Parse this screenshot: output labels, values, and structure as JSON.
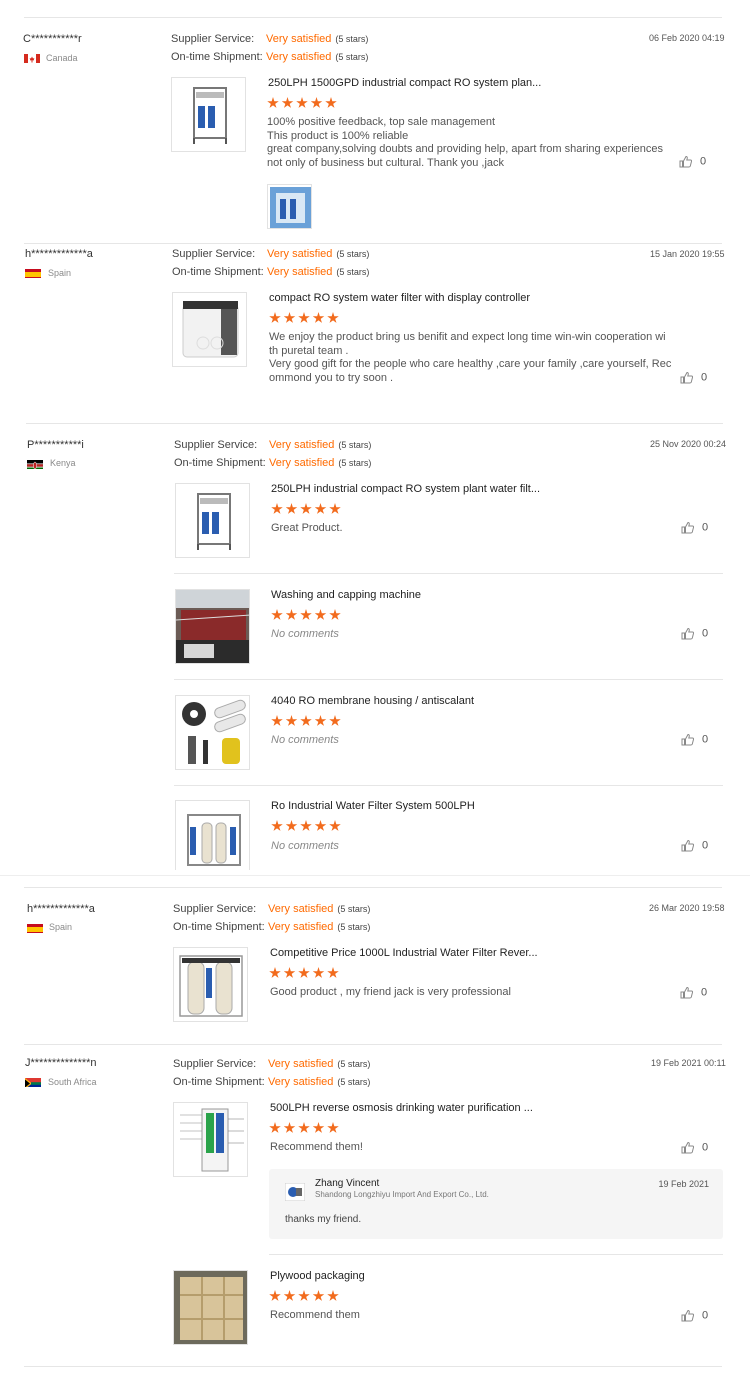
{
  "labels": {
    "supplier_service": "Supplier Service:",
    "ontime_shipment": "On-time Shipment:",
    "very_satisfied": "Very satisfied",
    "five_stars": "(5 stars)"
  },
  "colors": {
    "accent": "#ff6a00",
    "star": "#f26b1d",
    "divider": "#e6e6e6"
  },
  "reviews": [
    {
      "user": "C***********r",
      "country": "Canada",
      "flag": "canada-flag-icon",
      "date": "06 Feb 2020 04:19",
      "products": [
        {
          "name": "250LPH 1500GPD industrial compact RO system plan...",
          "comment": [
            "100% positive feedback, top sale management",
            "This product is 100% reliable",
            "great company,solving doubts and providing help, apart from sharing experiences",
            "not only of business but cultural. Thank you ,jack"
          ],
          "likes": "0",
          "thumb": "ro-system-thumbnail-icon"
        }
      ]
    },
    {
      "user": "h*************a",
      "country": "Spain",
      "flag": "spain-flag-icon",
      "date": "15 Jan 2020 19:55",
      "products": [
        {
          "name": "compact RO system water filter with display controller",
          "comment": [
            "We enjoy the product bring us benifit and expect long time win-win cooperation wi",
            "th puretal team .",
            "Very good gift for the people who care healthy ,care your family ,care yourself, Rec",
            "ommond you to try soon ."
          ],
          "likes": "0",
          "thumb": "water-filter-unit-icon"
        }
      ]
    },
    {
      "user": "P***********i",
      "country": "Kenya",
      "flag": "kenya-flag-icon",
      "date": "25 Nov 2020 00:24",
      "products": [
        {
          "name": "250LPH industrial compact RO system plant water filt...",
          "comment": [
            "Great Product."
          ],
          "likes": "0",
          "thumb": "ro-system-thumbnail-icon"
        },
        {
          "name": "Washing and capping machine",
          "no_comments": "No comments",
          "likes": "0",
          "thumb": "washing-machine-photo-icon"
        },
        {
          "name": "4040 RO membrane housing / antiscalant",
          "no_comments": "No comments",
          "likes": "0",
          "thumb": "membrane-housing-icon"
        },
        {
          "name": "Ro Industrial Water Filter System 500LPH",
          "no_comments": "No comments",
          "likes": "0",
          "thumb": "industrial-filter-icon"
        }
      ]
    },
    {
      "user": "h*************a",
      "country": "Spain",
      "flag": "spain-flag-icon",
      "date": "26 Mar 2020 19:58",
      "products": [
        {
          "name": "Competitive Price 1000L Industrial Water Filter Rever...",
          "comment": [
            "Good product , my friend jack is very professional"
          ],
          "likes": "0",
          "thumb": "industrial-filter-icon"
        }
      ]
    },
    {
      "user": "J**************n",
      "country": "South Africa",
      "flag": "south-africa-flag-icon",
      "date": "19 Feb 2021 00:11",
      "products": [
        {
          "name": "500LPH reverse osmosis drinking water purification ...",
          "comment": [
            "Recommend  them!"
          ],
          "likes": "0",
          "thumb": "ro-diagram-icon"
        },
        {
          "name": "Plywood packaging",
          "comment": [
            "Recommend them"
          ],
          "likes": "0",
          "thumb": "plywood-crate-icon"
        }
      ],
      "reply": {
        "name": "Zhang Vincent",
        "company": "Shandong Longzhiyu Import And Export Co., Ltd.",
        "date": "19 Feb 2021",
        "text": "thanks my friend."
      }
    }
  ]
}
